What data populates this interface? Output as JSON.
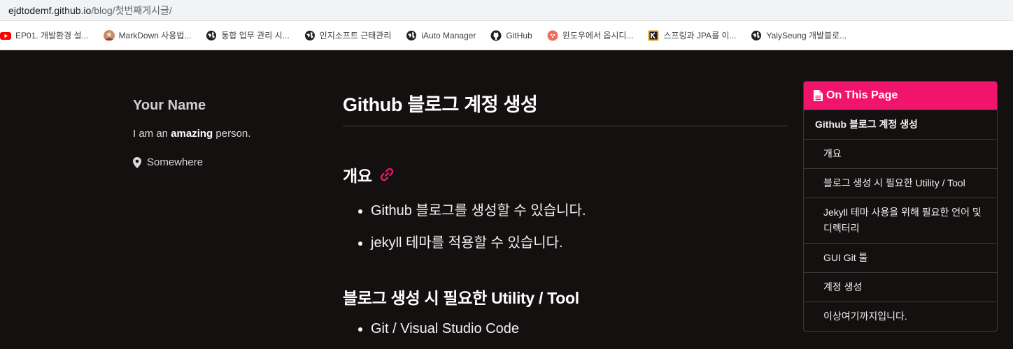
{
  "browser": {
    "url_host": "ejdtodemf.github.io",
    "url_path": "/blog/첫번째게시글/",
    "bookmarks": [
      {
        "label": "EP01. 개발환경 설...",
        "icon": "youtube-icon"
      },
      {
        "label": "MarkDown 사용법...",
        "icon": "avatar-icon"
      },
      {
        "label": "통합 업무 관리 시...",
        "icon": "globe-icon"
      },
      {
        "label": "인지소프트 근태관리",
        "icon": "globe-icon"
      },
      {
        "label": "iAuto Manager",
        "icon": "globe-icon"
      },
      {
        "label": "GitHub",
        "icon": "github-icon"
      },
      {
        "label": "윈도우에서 옵시디...",
        "icon": "obsidian-icon"
      },
      {
        "label": "스프링과 JPA를 이...",
        "icon": "k-icon"
      },
      {
        "label": "YalySeung 개발블로...",
        "icon": "globe-icon"
      }
    ]
  },
  "sidebar": {
    "name": "Your Name",
    "bio_pre": "I am an ",
    "bio_bold": "amazing",
    "bio_post": " person.",
    "location": "Somewhere"
  },
  "post": {
    "title": "Github 블로그 계정 생성",
    "sections": [
      {
        "heading": "개요",
        "items": [
          "Github 블로그를 생성할 수 있습니다.",
          "jekyll 테마를 적용할 수 있습니다."
        ]
      },
      {
        "heading": "블로그 생성 시 필요한 Utility / Tool",
        "items": [
          "Git / Visual Studio Code"
        ]
      }
    ]
  },
  "toc": {
    "header": "On This Page",
    "items": [
      {
        "label": "Github 블로그 계정 생성",
        "level": 1
      },
      {
        "label": "개요",
        "level": 2
      },
      {
        "label": "블로그 생성 시 필요한 Utility / Tool",
        "level": 2
      },
      {
        "label": "Jekyll 테마 사용을 위해 필요한 언어 및 디렉터리",
        "level": 2
      },
      {
        "label": "GUI Git 툴",
        "level": 2
      },
      {
        "label": "계정 생성",
        "level": 2
      },
      {
        "label": "이상여기까지입니다.",
        "level": 2
      }
    ]
  },
  "colors": {
    "accent": "#f0146c",
    "background": "#141010"
  }
}
